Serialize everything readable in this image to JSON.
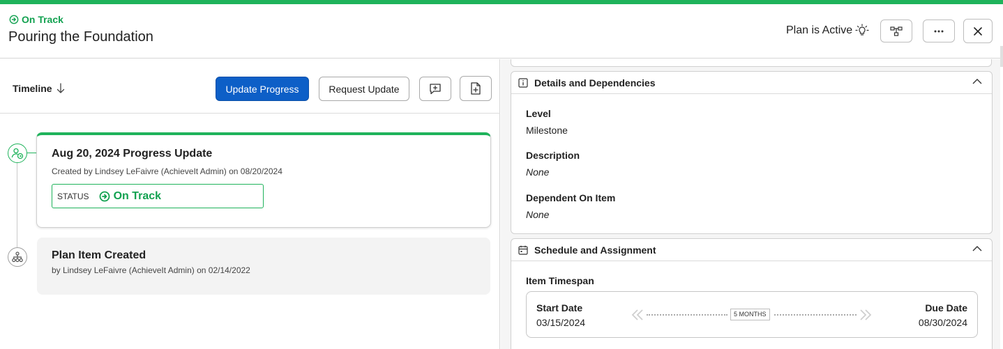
{
  "header": {
    "status": "On Track",
    "title": "Pouring the Foundation",
    "plan_state": "Plan is Active",
    "buttons": {
      "hierarchy_icon": "hierarchy-icon",
      "more_icon": "ellipsis-icon",
      "close_icon": "close-icon"
    }
  },
  "colors": {
    "accent_green": "#1fb35b",
    "primary_blue": "#0d5fc7",
    "status_green_text": "#12a150"
  },
  "toolbar": {
    "timeline_label": "Timeline",
    "update_progress": "Update Progress",
    "request_update": "Request Update"
  },
  "timeline": [
    {
      "title": "Aug 20, 2024 Progress Update",
      "subtitle": "Created by Lindsey LeFaivre (AchieveIt Admin) on 08/20/2024",
      "status_label": "STATUS",
      "status_value": "On Track"
    },
    {
      "title": "Plan Item Created",
      "subtitle": "by Lindsey LeFaivre (AchieveIt Admin) on 02/14/2022"
    }
  ],
  "details": {
    "heading": "Details and Dependencies",
    "level_label": "Level",
    "level_value": "Milestone",
    "description_label": "Description",
    "description_value": "None",
    "dependent_label": "Dependent On Item",
    "dependent_value": "None"
  },
  "schedule": {
    "heading": "Schedule and Assignment",
    "timespan_label": "Item Timespan",
    "start_label": "Start Date",
    "start_value": "03/15/2024",
    "due_label": "Due Date",
    "due_value": "08/30/2024",
    "duration": "5 MONTHS"
  }
}
